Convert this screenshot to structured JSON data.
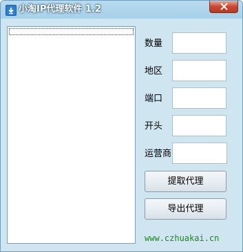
{
  "window": {
    "title": "小淘IP代理软件 1.2",
    "icon": "download-arrow-icon",
    "close_icon": "close-icon"
  },
  "list": {
    "items": []
  },
  "form": {
    "fields": [
      {
        "key": "quantity",
        "label": "数量",
        "value": ""
      },
      {
        "key": "region",
        "label": "地区",
        "value": ""
      },
      {
        "key": "port",
        "label": "端口",
        "value": ""
      },
      {
        "key": "prefix",
        "label": "开头",
        "value": ""
      },
      {
        "key": "carrier",
        "label": "运营商",
        "value": ""
      }
    ]
  },
  "buttons": {
    "fetch_label": "提取代理",
    "export_label": "导出代理"
  },
  "footer": {
    "website": "www.czhuakai.cn"
  },
  "colors": {
    "client_bg": "#cfe6f1",
    "title_bar": "#a7d0e9",
    "close_red": "#c8472f",
    "website_green": "#1a8a1a"
  }
}
